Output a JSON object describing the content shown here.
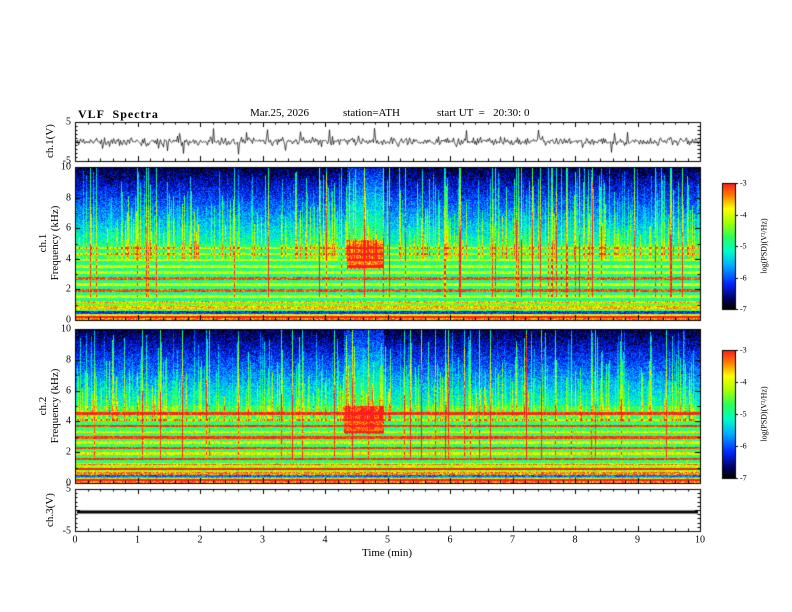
{
  "header": {
    "title": "VLF  Spectra",
    "date": "Mar.25, 2026",
    "station": "station=ATH",
    "start_ut": "start UT  =   20:30: 0"
  },
  "axes": {
    "xlabel": "Time (min)",
    "x_ticks": [
      0,
      1,
      2,
      3,
      4,
      5,
      6,
      7,
      8,
      9,
      10
    ],
    "wave_yticks": [
      5,
      -5
    ],
    "spec_yticks": [
      0,
      2,
      4,
      6,
      8,
      10
    ],
    "colorbar_ticks": [
      -3,
      -4,
      -5,
      -6,
      -7
    ]
  },
  "labels": {
    "ch1_wave": "ch.1(V)",
    "ch1_spec_line1": "ch.1",
    "ch1_spec_line2": "Frequency (kHz)",
    "ch2_spec_line1": "ch.2",
    "ch2_spec_line2": "Frequency (kHz)",
    "ch3_wave": "ch.3(V)",
    "colorbar": "log(PSD)(V²/Hz)"
  },
  "colors": {
    "background": "#ffffff",
    "trace": "#000000",
    "frame": "#000000",
    "colormap": [
      [
        0.0,
        "#000000"
      ],
      [
        0.08,
        "#000066"
      ],
      [
        0.2,
        "#0028ff"
      ],
      [
        0.34,
        "#00aaff"
      ],
      [
        0.46,
        "#00ffc8"
      ],
      [
        0.57,
        "#28ff5a"
      ],
      [
        0.69,
        "#aaff00"
      ],
      [
        0.8,
        "#ffff00"
      ],
      [
        0.9,
        "#ff8200"
      ],
      [
        1.0,
        "#ff1e1e"
      ]
    ]
  },
  "chart_data": [
    {
      "id": "ch1_voltage",
      "type": "line",
      "ylabel": "ch.1(V)",
      "ylim": [
        -5,
        5
      ],
      "yticks": [
        5,
        -5
      ],
      "xlim": [
        0,
        10
      ],
      "xlabel": "Time (min)",
      "signal": {
        "noise_amplitude_V": 0.9,
        "spike_amplitude_V": 4,
        "character": "continuous broadband noise trace around 0 V with frequent impulsive spikes up to ±4 V"
      }
    },
    {
      "id": "ch1_spectrogram",
      "type": "heatmap",
      "ylabel": "ch.1 Frequency (kHz)",
      "ylim": [
        0,
        10
      ],
      "yticks": [
        0,
        2,
        4,
        6,
        8,
        10
      ],
      "xlim": [
        0,
        10
      ],
      "zlabel": "log(PSD)(V²/Hz)",
      "zlim": [
        -7,
        -3
      ],
      "base_levels_db": {
        "low": -3.9,
        "low_mid": -4.5,
        "mid": -4.9,
        "high_start": -5.1,
        "high_end": -6.8
      },
      "bands_khz": [
        0.15,
        0.8,
        1.15,
        1.5,
        1.9,
        2.3,
        2.7,
        3.1,
        3.5,
        3.9,
        4.3,
        4.7
      ],
      "strong_bands_khz": [
        0.15,
        1.9,
        2.7
      ],
      "notch_khz": [
        0.45
      ],
      "event": {
        "t_start": 4.35,
        "t_end": 4.95,
        "f_start": 3.3,
        "f_end": 5.2,
        "description": "transient emission patch near 4-5 kHz around t = 4.5-5 min"
      },
      "texture": "dense vertical sferic streaks from 4-10 kHz over dark blue background; green 1-5 kHz band; yellow/red hum lines below 1 kHz"
    },
    {
      "id": "ch2_spectrogram",
      "type": "heatmap",
      "ylabel": "ch.2 Frequency (kHz)",
      "ylim": [
        0,
        10
      ],
      "yticks": [
        0,
        2,
        4,
        6,
        8,
        10
      ],
      "xlim": [
        0,
        10
      ],
      "zlabel": "log(PSD)(V²/Hz)",
      "zlim": [
        -7,
        -3
      ],
      "base_levels_db": {
        "low": -3.8,
        "low_mid": -4.3,
        "mid": -4.75,
        "high_start": -5.1,
        "high_end": -6.8
      },
      "bands_khz": [
        0.15,
        0.6,
        0.9,
        1.2,
        1.55,
        1.9,
        2.25,
        2.6,
        2.95,
        3.3,
        3.7,
        4.1,
        4.5
      ],
      "strong_bands_khz": [
        0.15,
        0.9,
        1.55,
        2.25,
        2.95,
        3.7,
        4.5
      ],
      "notch_khz": [
        0.4
      ],
      "event": {
        "t_start": 4.3,
        "t_end": 4.95,
        "f_start": 3.2,
        "f_end": 5.0,
        "description": "transient emission patch near 4-5 kHz around t = 4.5-5 min"
      },
      "texture": "many strong yellow/red horizontal harmonic lines below 4.5 kHz; vertical sferic streaks 5-10 kHz"
    },
    {
      "id": "ch3_voltage",
      "type": "line",
      "ylabel": "ch.3(V)",
      "ylim": [
        -5,
        5
      ],
      "yticks": [
        5,
        -5
      ],
      "xlim": [
        0,
        10
      ],
      "xlabel": "Time (min)",
      "signal": {
        "constant_level_V": -0.5,
        "character": "flat thick black trace (no signal on channel 3)"
      }
    }
  ]
}
